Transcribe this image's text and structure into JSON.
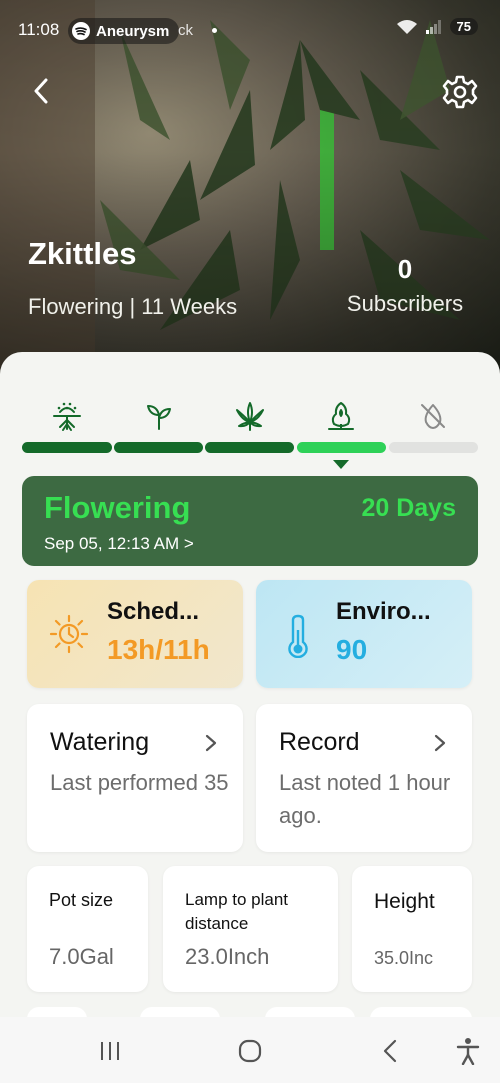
{
  "status_bar": {
    "time": "11:08",
    "now_playing": "Aneurysm",
    "extra": "ck",
    "battery": "75"
  },
  "plant": {
    "name": "Zkittles",
    "stage_summary": "Flowering | 11 Weeks",
    "subscribers_count": "0",
    "subscribers_label": "Subscribers"
  },
  "stages": {
    "items": [
      {
        "name": "germination-icon",
        "status": "done"
      },
      {
        "name": "seedling-icon",
        "status": "done"
      },
      {
        "name": "vegetative-icon",
        "status": "done"
      },
      {
        "name": "flowering-icon",
        "status": "current"
      },
      {
        "name": "harvest-icon",
        "status": "upcoming"
      }
    ],
    "colors": {
      "done": "#146a2a",
      "current": "#2ed158",
      "upcoming": "#e1e2e0"
    }
  },
  "current_stage": {
    "name": "Flowering",
    "days": "20 Days",
    "started": "Sep 05, 12:13 AM >"
  },
  "schedule": {
    "title": "Sched...",
    "value": "13h/11h",
    "icon": "sun-icon"
  },
  "environment": {
    "title": "Enviro...",
    "value": "90",
    "icon": "thermometer-icon"
  },
  "watering": {
    "title": "Watering",
    "description": "Last performed 35"
  },
  "record": {
    "title": "Record",
    "description": "Last noted 1 hour ago."
  },
  "metrics": {
    "pot_size": {
      "label": "Pot size",
      "value": "7.0Gal"
    },
    "lamp_distance": {
      "label": "Lamp to plant distance",
      "value": "23.0Inch"
    },
    "height": {
      "label": "Height",
      "value": "35.0Inc"
    }
  },
  "nav": [
    "recent-apps-icon",
    "home-icon",
    "back-icon",
    "accessibility-icon"
  ]
}
